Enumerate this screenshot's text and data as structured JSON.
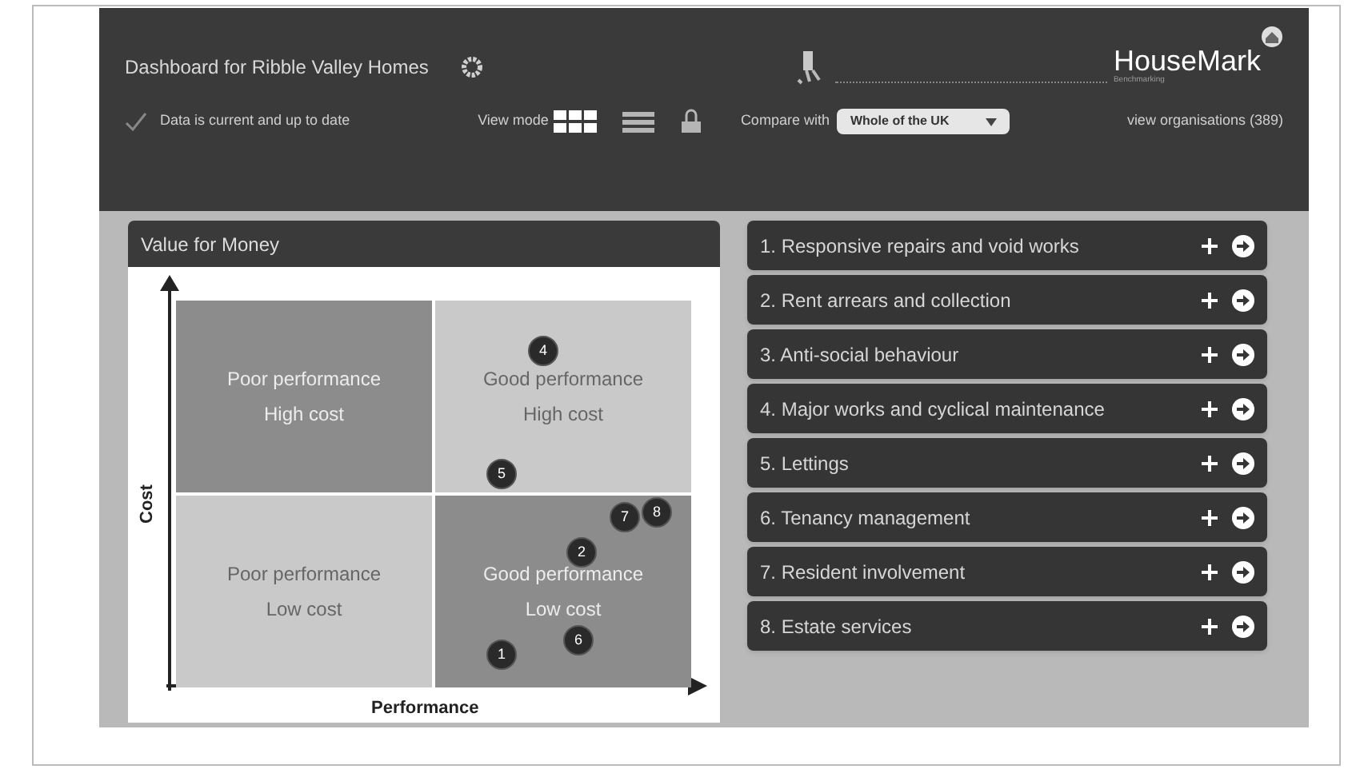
{
  "header": {
    "title": "Dashboard for Ribble Valley Homes",
    "brand": "HouseMark",
    "brand_tagline": "Benchmarking",
    "status": "Data is current and up to date",
    "view_mode_label": "View mode",
    "view_modes": [
      {
        "kind": "grid",
        "selected": true
      },
      {
        "kind": "list",
        "selected": false
      },
      {
        "kind": "lock",
        "selected": false
      }
    ],
    "compare_label": "Compare with",
    "compare_value": "Whole of the UK",
    "organisations_link": "view organisations (389)"
  },
  "value_for_money": {
    "title": "Value for Money",
    "y_axis": "Cost",
    "x_axis": "Performance",
    "quadrants": [
      {
        "lines": [
          "Poor performance",
          "High cost"
        ],
        "kind": "dark"
      },
      {
        "lines": [
          "Good performance",
          "High cost"
        ],
        "kind": "light"
      },
      {
        "lines": [
          "Poor performance",
          "Low cost"
        ],
        "kind": "light"
      },
      {
        "lines": [
          "Good performance",
          "Low cost"
        ],
        "kind": "dark"
      }
    ],
    "markers": [
      {
        "label": "4"
      },
      {
        "label": "5"
      },
      {
        "label": "7"
      },
      {
        "label": "8"
      },
      {
        "label": "2"
      },
      {
        "label": "6"
      },
      {
        "label": "1"
      }
    ]
  },
  "categories": [
    {
      "label": "1. Responsive repairs and void works"
    },
    {
      "label": "2. Rent arrears and collection"
    },
    {
      "label": "3. Anti-social behaviour"
    },
    {
      "label": "4. Major works and cyclical maintenance"
    },
    {
      "label": "5. Lettings"
    },
    {
      "label": "6. Tenancy management"
    },
    {
      "label": "7. Resident involvement"
    },
    {
      "label": "8. Estate services"
    }
  ]
}
